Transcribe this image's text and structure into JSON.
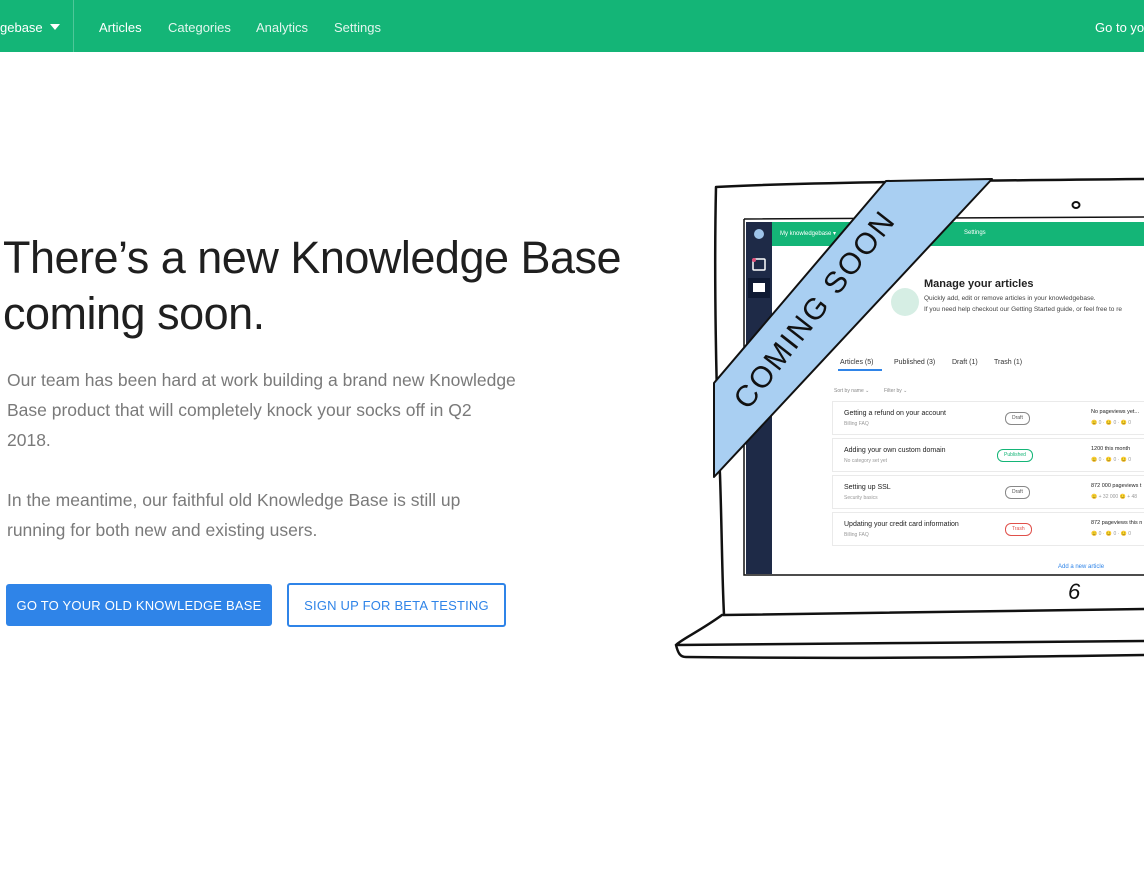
{
  "nav": {
    "kb_switcher": "gebase",
    "items": [
      "Articles",
      "Categories",
      "Analytics",
      "Settings"
    ],
    "goto": "Go to yo"
  },
  "hero": {
    "headline_line1": "There’s a new Knowledge Base",
    "headline_line2": "coming soon.",
    "para1_line1": "Our team has been hard at work building a brand new Knowledge",
    "para1_line2": "Base product that will completely knock your socks off in Q2",
    "para1_line3": "2018.",
    "para2_line1": "In the meantime, our faithful old Knowledge Base is still up",
    "para2_line2": "running for both new and existing users.",
    "primary_button": "GO TO YOUR OLD KNOWLEDGE BASE",
    "secondary_button": "SIGN UP FOR BETA TESTING"
  },
  "illustration": {
    "ribbon": "COMING SOON",
    "app": {
      "kb_label": "My knowledgebase ▾",
      "settings": "Settings",
      "title": "Manage your articles",
      "subtitle1": "Quickly add, edit or remove articles in your knowledgebase.",
      "subtitle2": "If you need help checkout our Getting Started guide, or feel free to re",
      "tabs": [
        "Articles (5)",
        "Published (3)",
        "Draft (1)",
        "Trash (1)"
      ],
      "sort": "Sort by name ⌄",
      "filter": "Filter by ⌄",
      "rows": [
        {
          "title": "Getting a refund on your account",
          "category": "Billing FAQ",
          "status": "Draft",
          "views": "No pageviews yet...",
          "emoji": "😐 0 · 😐 0 · 😐 0"
        },
        {
          "title": "Adding your own custom domain",
          "category": "No category set yet",
          "status": "Published",
          "views": "1200 this month",
          "emoji": "😐 0 · 😐 0 · 😐 0"
        },
        {
          "title": "Setting up SSL",
          "category": "Security basics",
          "status": "Draft",
          "views": "872 000 pageviews t",
          "emoji": "😐 + 32 000 😐 + 48"
        },
        {
          "title": "Updating your credit card information",
          "category": "Billing FAQ",
          "status": "Trash",
          "views": "872 pageviews this n",
          "emoji": "😐 0 · 😐 0 · 😐 0"
        }
      ],
      "add_link": "Add a new article"
    },
    "doodle_number": "6",
    "colors": {
      "ribbon": "#a9cff2",
      "sidebar": "#1e2a47",
      "brand": "#14b577"
    }
  }
}
